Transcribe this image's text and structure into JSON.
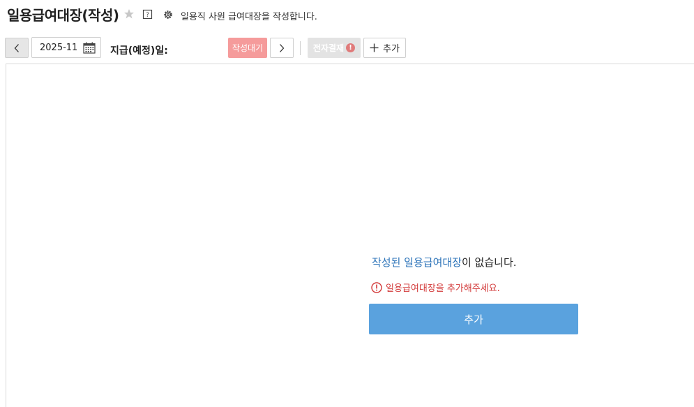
{
  "header": {
    "title": "일용급여대장(작성)",
    "description": "일용직 사원 급여대장을 작성합니다.",
    "icons": {
      "favorite": "star-icon",
      "help": "help-icon",
      "settings": "gear-icon"
    }
  },
  "toolbar": {
    "prev_icon": "chevron-left-icon",
    "date_value": "2025-11",
    "calendar_icon": "calendar-icon",
    "pay_date_label": "지급(예정)일:",
    "status_label": "작성대기",
    "next_icon": "chevron-right-icon",
    "approval_label": "전자결재",
    "approval_alert": "!",
    "add_label": "추가"
  },
  "empty_state": {
    "highlight": "작성된 일용급여대장",
    "message_rest": "이 없습니다.",
    "warning": "일용급여대장을 추가해주세요.",
    "add_button": "추가"
  },
  "colors": {
    "status_button": "#f59b9b",
    "approval_button": "#e3e3e3",
    "primary_button": "#5aa2de",
    "highlight_text": "#2a72b8",
    "warning_text": "#d33a3a"
  }
}
